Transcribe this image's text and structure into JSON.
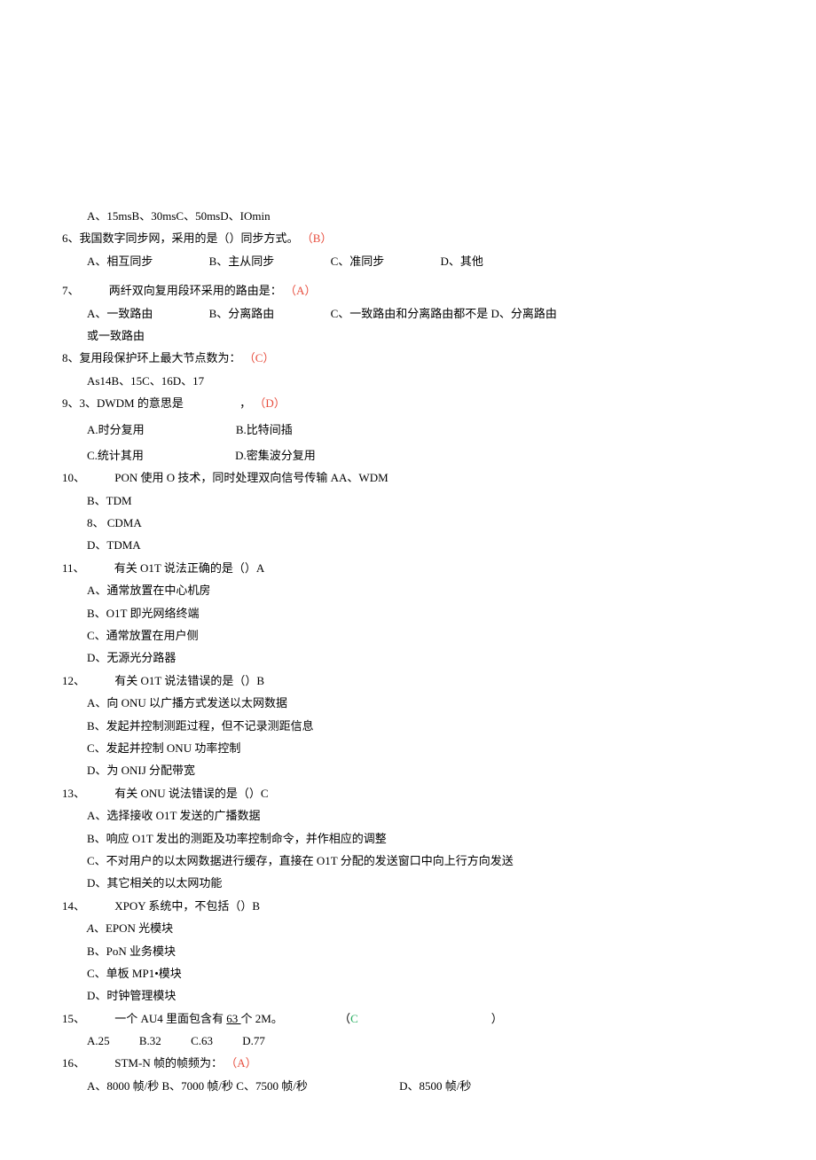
{
  "q5_opts": "A、15msB、30msC、50msD、IOmin",
  "q6": {
    "stem_pre": "6、我国数字同步网，采用的是（）同步方式。",
    "ans": "（B）",
    "a": "A、相互同步",
    "b": "B、主从同步",
    "c": "C、准同步",
    "d": "D、其他"
  },
  "q7": {
    "num": "7、",
    "stem": "两纤双向复用段环采用的路由是：",
    "ans": "（A）",
    "a": "A、一致路由",
    "b": "B、分离路由",
    "c": "C、一致路由和分离路由都不是 D、分离路由",
    "cont": "或一致路由"
  },
  "q8": {
    "stem": "8、复用段保护环上最大节点数为：",
    "ans": "（C）",
    "opts": "As14B、15C、16D、17"
  },
  "q9": {
    "stem_pre": "9、3、DWDM 的意思是",
    "comma": "，",
    "ans": "（D）",
    "a": "A.时分复用",
    "b": "B.比特间插",
    "c": "C.统计其用",
    "d": "D.密集波分复用"
  },
  "q10": {
    "num": "10、",
    "stem": "PON 使用 O 技术，同时处理双向信号传输 AA、WDM",
    "b": "B、TDM",
    "c": "8、 CDMA",
    "d": "D、TDMA"
  },
  "q11": {
    "num": "11、",
    "stem": "有关 O1T 说法正确的是（）A",
    "a": "A、通常放置在中心机房",
    "b": "B、O1T 即光网络终端",
    "c": "C、通常放置在用户侧",
    "d": "D、无源光分路器"
  },
  "q12": {
    "num": "12、",
    "stem": "有关 O1T 说法错误的是（）B",
    "a": "A、向 ONU 以广播方式发送以太网数据",
    "b": "B、发起并控制测距过程，但不记录测距信息",
    "c": "C、发起并控制 ONU 功率控制",
    "d": "D、为 ONIJ 分配带宽"
  },
  "q13": {
    "num": "13、",
    "stem": "有关 ONU 说法错误的是（）C",
    "a": "A、选择接收 O1T 发送的广播数据",
    "b": "B、响应 O1T 发出的测距及功率控制命令，并作相应的调整",
    "c": "C、不对用户的以太网数据进行缓存，直接在 O1T 分配的发送窗口中向上行方向发送",
    "d": "D、其它相关的以太网功能"
  },
  "q14": {
    "num": "14、",
    "stem": "XPOY 系统中，不包括（）B",
    "a_pre": "A",
    "a": "、EPON 光模块",
    "b": "B、PoN 业务模块",
    "c": "C、单板 MP1•模块",
    "d": "D、时钟管理模块"
  },
  "q15": {
    "num": "15、",
    "stem_pre": "一个 AU4 里面包含有 ",
    "underlined": "63 ",
    "stem_post": "个 2M。",
    "paren_l": "（",
    "ans": "C",
    "paren_r": "）",
    "a": "A.25",
    "b": "B.32",
    "c": "C.63",
    "d": "D.77"
  },
  "q16": {
    "num": "16、",
    "stem": "STM-N 帧的帧频为：",
    "ans": "（A）",
    "abc": "A、8000 帧/秒 B、7000 帧/秒 C、7500 帧/秒",
    "d": "D、8500 帧/秒"
  }
}
